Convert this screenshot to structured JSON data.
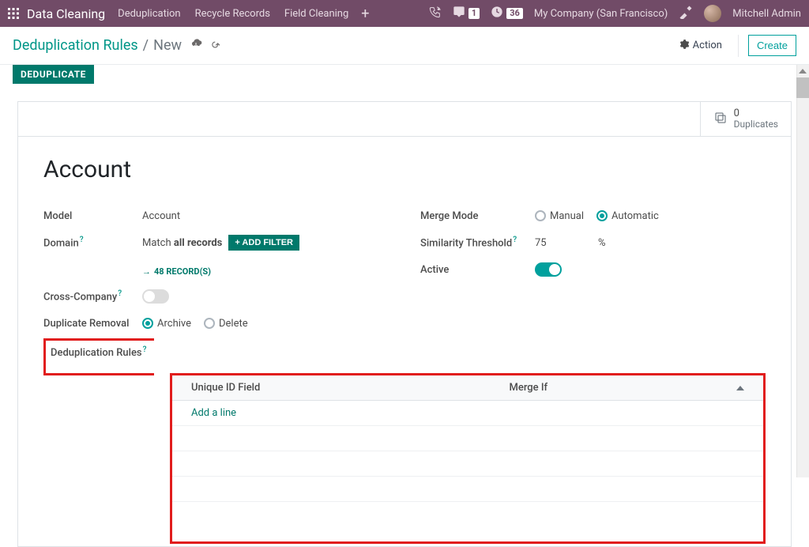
{
  "topbar": {
    "brand": "Data Cleaning",
    "nav": [
      {
        "label": "Deduplication"
      },
      {
        "label": "Recycle Records"
      },
      {
        "label": "Field Cleaning"
      }
    ],
    "messages_badge": "1",
    "activities_badge": "36",
    "company": "My Company (San Francisco)",
    "user": "Mitchell Admin"
  },
  "breadcrumb": {
    "root": "Deduplication Rules",
    "current": "New",
    "action_label": "Action",
    "create_label": "Create"
  },
  "tab": {
    "deduplicate": "DEDUPLICATE"
  },
  "stat": {
    "count": "0",
    "label": "Duplicates"
  },
  "record": {
    "title": "Account",
    "labels": {
      "model": "Model",
      "domain": "Domain",
      "cross_company": "Cross-Company",
      "duplicate_removal": "Duplicate Removal",
      "deduplication_rules": "Deduplication Rules",
      "merge_mode": "Merge Mode",
      "similarity_threshold": "Similarity Threshold",
      "active": "Active"
    },
    "model_value": "Account",
    "domain_prefix": "Match ",
    "domain_bold": "all records",
    "add_filter": "+ ADD FILTER",
    "records_link": "48 RECORD(S)",
    "duplicate_removal_options": {
      "archive": "Archive",
      "delete": "Delete"
    },
    "merge_mode_options": {
      "manual": "Manual",
      "automatic": "Automatic"
    },
    "similarity_value": "75",
    "similarity_unit": "%"
  },
  "rules_table": {
    "col_unique": "Unique ID Field",
    "col_merge": "Merge If",
    "add_line": "Add a line"
  }
}
